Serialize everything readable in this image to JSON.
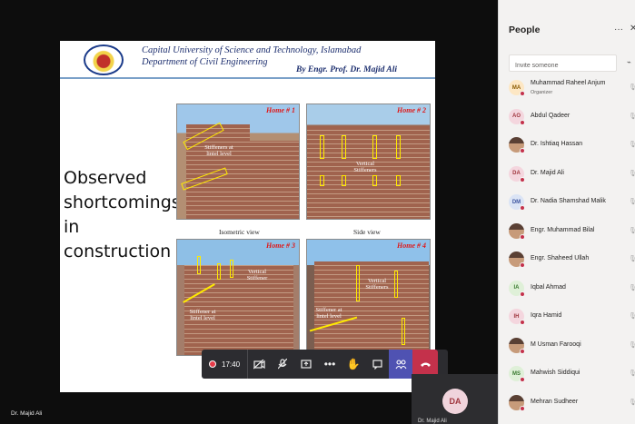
{
  "slide": {
    "university": "Capital University of Science and Technology, Islamabad",
    "department": "Department of Civil Engineering",
    "author": "By Engr. Prof. Dr. Majid Ali",
    "heading": "Observed shortcomings in construction",
    "photos": [
      {
        "label": "Home # 1",
        "notes": [
          "Stiffeners at lintel level"
        ]
      },
      {
        "label": "Home # 2",
        "notes": [
          "Vertical Stiffeners"
        ]
      },
      {
        "label": "Home # 3",
        "notes": [
          "Vertical Stiffener",
          "Stiffener at lintel level"
        ]
      },
      {
        "label": "Home # 4",
        "notes": [
          "Vertical Stiffeners",
          "Stiffener at lintel level"
        ]
      }
    ],
    "captions": [
      "Isometric view",
      "Side view"
    ]
  },
  "call": {
    "timer": "17:40",
    "presenter": "Dr. Majid Ali",
    "self_initials": "DA",
    "self_name": "Dr. Majid Ali"
  },
  "people": {
    "title": "People",
    "invite_placeholder": "Invite someone",
    "participants": [
      {
        "name": "Muhammad Raheel Anjum",
        "role": "Organizer",
        "initials": "MA",
        "avatar_bg": "#fde7c4",
        "avatar_fg": "#8a5a00",
        "status": "#c4314b"
      },
      {
        "name": "Abdul Qadeer",
        "role": "",
        "initials": "AO",
        "avatar_bg": "#f4d6de",
        "avatar_fg": "#a0373f",
        "status": "#c4314b"
      },
      {
        "name": "Dr. Ishtiaq Hassan",
        "role": "",
        "initials": "",
        "avatar_bg": "photo",
        "avatar_fg": "",
        "status": "#c4314b"
      },
      {
        "name": "Dr. Majid Ali",
        "role": "",
        "initials": "DA",
        "avatar_bg": "#f4d6de",
        "avatar_fg": "#a0373f",
        "status": "#c4314b"
      },
      {
        "name": "Dr. Nadia Shamshad Malik",
        "role": "",
        "initials": "DM",
        "avatar_bg": "#dbe4f5",
        "avatar_fg": "#3d55a0",
        "status": "#c4314b"
      },
      {
        "name": "Engr. Muhammad Bilal",
        "role": "",
        "initials": "",
        "avatar_bg": "photo",
        "avatar_fg": "",
        "status": "#c4314b"
      },
      {
        "name": "Engr. Shaheed Ullah",
        "role": "",
        "initials": "",
        "avatar_bg": "photo",
        "avatar_fg": "",
        "status": "#c4314b"
      },
      {
        "name": "Iqbal Ahmad",
        "role": "",
        "initials": "IA",
        "avatar_bg": "#dff0d8",
        "avatar_fg": "#3a7a30",
        "status": "#c4314b"
      },
      {
        "name": "Iqra Hamid",
        "role": "",
        "initials": "IH",
        "avatar_bg": "#f4d6de",
        "avatar_fg": "#a0373f",
        "status": "#c4314b"
      },
      {
        "name": "M Usman Farooqi",
        "role": "",
        "initials": "",
        "avatar_bg": "photo",
        "avatar_fg": "",
        "status": "#c4314b"
      },
      {
        "name": "Mahwish Siddiqui",
        "role": "",
        "initials": "MS",
        "avatar_bg": "#dff0d8",
        "avatar_fg": "#3a7a30",
        "status": "#c4314b"
      },
      {
        "name": "Mehran Sudheer",
        "role": "",
        "initials": "",
        "avatar_bg": "photo",
        "avatar_fg": "",
        "status": "#c4314b"
      }
    ]
  }
}
